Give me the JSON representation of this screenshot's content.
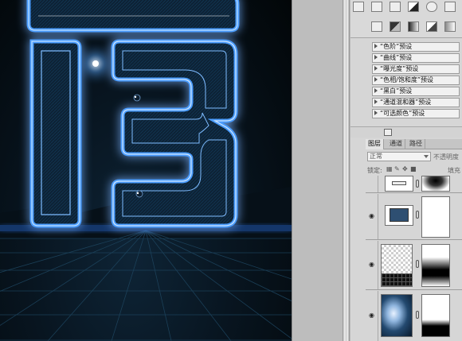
{
  "adjustments": {
    "presets": [
      "“色阶”预设",
      "“曲线”预设",
      "“曝光度”预设",
      "“色相/饱和度”预设",
      "“黑白”预设",
      "“通道混和器”预设",
      "“可选颜色”预设"
    ]
  },
  "layers_panel": {
    "tabs": [
      "图层",
      "通道",
      "路径"
    ],
    "blend_mode": "正常",
    "opacity_label": "不透明度",
    "lock_label": "锁定:",
    "fill_label": "填充"
  },
  "colors": {
    "neon_blue": "#2f7dff",
    "neon_glow": "#5aa8ff",
    "fill_dark": "#0a2034",
    "layer_fill_color": "#2e4f72"
  }
}
